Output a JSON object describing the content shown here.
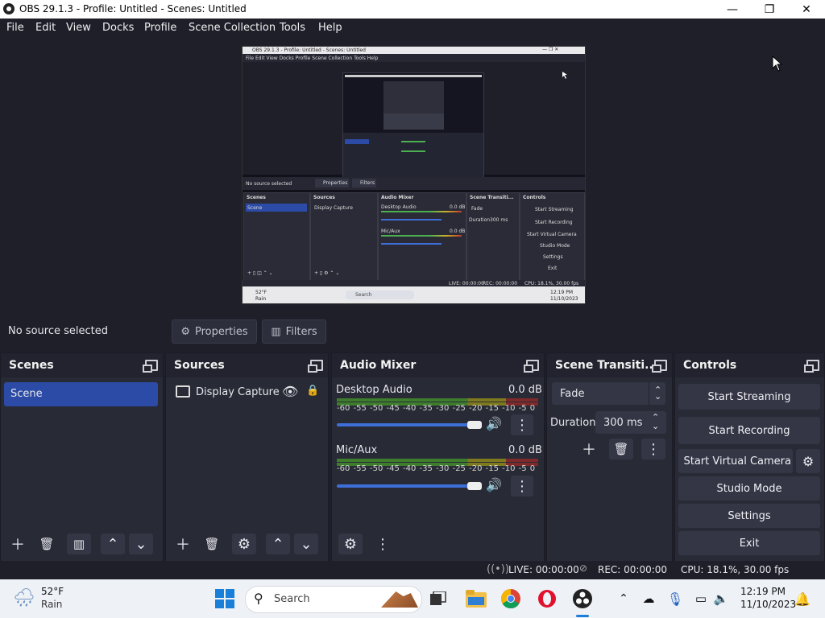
{
  "window": {
    "title": "OBS 29.1.3 - Profile: Untitled - Scenes: Untitled",
    "minimize": "—",
    "maximize": "❐",
    "close": "✕"
  },
  "menu": [
    "File",
    "Edit",
    "View",
    "Docks",
    "Profile",
    "Scene Collection",
    "Tools",
    "Help"
  ],
  "source_bar": {
    "no_source": "No source selected",
    "properties": "Properties",
    "filters": "Filters"
  },
  "scenes": {
    "title": "Scenes",
    "items": [
      "Scene"
    ]
  },
  "sources": {
    "title": "Sources",
    "items": [
      "Display Capture"
    ]
  },
  "audio_mixer": {
    "title": "Audio Mixer",
    "channels": [
      {
        "name": "Desktop Audio",
        "level": "0.0 dB",
        "volume_fraction": 0.95
      },
      {
        "name": "Mic/Aux",
        "level": "0.0 dB",
        "volume_fraction": 0.95
      }
    ],
    "ticks": "-60 -55 -50 -45 -40 -35 -30 -25 -20 -15 -10 -5 0"
  },
  "transitions": {
    "title": "Scene Transiti...",
    "selected": "Fade",
    "duration_label": "Duration",
    "duration_value": "300 ms"
  },
  "controls": {
    "title": "Controls",
    "start_streaming": "Start Streaming",
    "start_recording": "Start Recording",
    "start_virtual_camera": "Start Virtual Camera",
    "studio_mode": "Studio Mode",
    "settings": "Settings",
    "exit": "Exit"
  },
  "status": {
    "live": "LIVE: 00:00:00",
    "rec": "REC: 00:00:00",
    "cpu": "CPU: 18.1%, 30.00 fps"
  },
  "taskbar": {
    "weather_temp": "52°F",
    "weather_desc": "Rain",
    "search_placeholder": "Search",
    "time": "12:19 PM",
    "date": "11/10/2023"
  },
  "mini": {
    "title": "OBS 29.1.3 - Profile: Untitled - Scenes: Untitled",
    "menu": "File  Edit  View  Docks  Profile  Scene Collection  Tools  Help",
    "no_source": "No source selected",
    "properties": "Properties",
    "filters": "Filters",
    "scenes": "Scenes",
    "scene": "Scene",
    "sources": "Sources",
    "display_capture": "Display Capture",
    "audio_mixer": "Audio Mixer",
    "desktop_audio": "Desktop Audio",
    "mic_aux": "Mic/Aux",
    "level": "0.0 dB",
    "transitions": "Scene Transiti...",
    "fade": "Fade",
    "duration": "Duration",
    "duration_value": "300 ms",
    "controls": "Controls",
    "start_streaming": "Start Streaming",
    "start_recording": "Start Recording",
    "start_virtual_camera": "Start Virtual Camera",
    "studio_mode": "Studio Mode",
    "settings": "Settings",
    "exit": "Exit",
    "live": "LIVE: 00:00:00",
    "rec": "REC: 00:00:00",
    "cpu": "CPU: 18.1%, 30.00 fps",
    "weather_temp": "52°F",
    "weather_desc": "Rain",
    "search": "Search",
    "time": "12:19 PM",
    "date": "11/10/2023"
  }
}
